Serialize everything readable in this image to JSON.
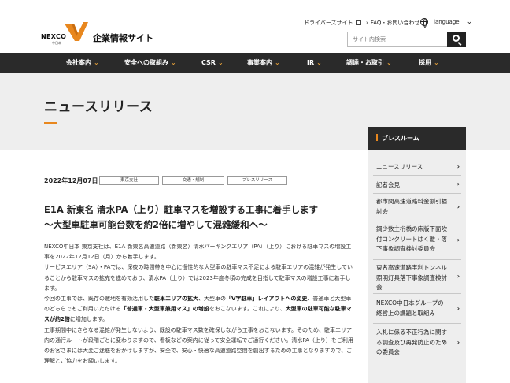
{
  "header": {
    "logo_text": "NEXCO",
    "logo_sub": "中日本",
    "site_name": "企業情報サイト",
    "driver_link": "ドライバーズサイト",
    "faq_link": "FAQ・お問い合わせ",
    "language_label": "language",
    "search_placeholder": "サイト内検索"
  },
  "nav": {
    "items": [
      {
        "label": "会社案内"
      },
      {
        "label": "安全への取組み"
      },
      {
        "label": "CSR"
      },
      {
        "label": "事業案内"
      },
      {
        "label": "IR"
      },
      {
        "label": "調達・お取引"
      },
      {
        "label": "採用"
      }
    ]
  },
  "page": {
    "title": "ニュースリリース"
  },
  "article": {
    "date": "2022年12月07日",
    "tags": [
      "東京支社",
      "交通・規制",
      "プレスリリース"
    ],
    "headline_1": "E1A 新東名 清水PA（上り）駐車マスを増設する工事に着手します",
    "headline_2": "〜大型車駐車可能台数を約2倍に増やして混雑緩和へ〜",
    "p1": "NEXCO中日本 東京支社は、E1A 新東名高速道路（新東名）清水パーキングエリア（PA）（上り）における駐車マスの増設工事を2022年12月12日（月）から着手します。",
    "p2": "サービスエリア（SA）・PAでは、深夜の時間帯を中心に慢性的な大型車の駐車マス不足による駐車エリアの混雑が発生していることから駐車マスの拡充を進めており、清水PA（上り）では2023年度冬頃の完成を目指して駐車マスの増設工事に着手します。",
    "p3_a": "今回の工事では、既存の敷地を有効活用した",
    "p3_b1": "駐車エリアの拡大",
    "p3_c": "、大型車の",
    "p3_b2": "「V字駐車」レイアウトへの変更",
    "p3_d": "、普通車と大型車のどちらでもご利用いただける",
    "p3_b3": "「普通車・大型車兼用マス」の増設",
    "p3_e": "をおこないます。これにより、",
    "p3_b4": "大型車の駐車可能な駐車マスが約2倍",
    "p3_f": "に増加します。",
    "p4": "工事期間中にさらなる混雑が発生しないよう、既設の駐車マス数を確保しながら工事をおこないます。そのため、駐車エリア内の通行ルートが段階ごとに変わりますので、看板などの案内に従って安全運転でご通行ください。清水PA（上り）をご利用のお客さまには大変ご迷惑をおかけしますが、安全で、安心・快適な高速道路空間を創出するための工事となりますので、ご理解とご協力をお願いします。"
  },
  "sidebar": {
    "heading": "プレスルーム",
    "items": [
      {
        "label": "ニュースリリース"
      },
      {
        "label": "記者会見"
      },
      {
        "label": "都市間高速道路料金割引検討会"
      },
      {
        "label": "鋼少数主桁橋の床版下面吹付コンクリートはく離・落下事象調査検討委員会"
      },
      {
        "label": "東名高速道路宇利トンネル照明灯具落下事象調査検討会"
      },
      {
        "label": "NEXCO中日本グループの経営上の課題と取組み"
      },
      {
        "label": "入札に係る不正行為に関する調査及び再発防止のための委員会"
      }
    ]
  },
  "colors": {
    "accent": "#e8871e",
    "nav_bg": "#2a2a2a",
    "band_bg": "#eeeeee"
  }
}
